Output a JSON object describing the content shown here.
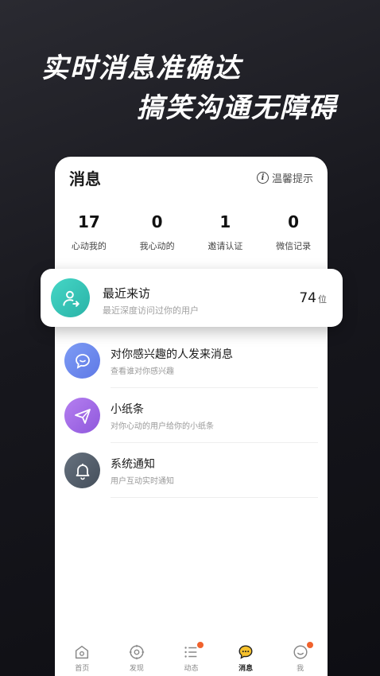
{
  "promo": {
    "headline_1": "实时消息准确达",
    "headline_2": "搞笑沟通无障碍"
  },
  "header": {
    "title": "消息",
    "tip_label": "温馨提示",
    "tip_icon": "info-icon"
  },
  "stats": [
    {
      "value": "17",
      "label": "心动我的"
    },
    {
      "value": "0",
      "label": "我心动的"
    },
    {
      "value": "1",
      "label": "邀请认证"
    },
    {
      "value": "0",
      "label": "微信记录"
    }
  ],
  "recent_visitors": {
    "title": "最近来访",
    "subtitle": "最近深度访问过你的用户",
    "count": "74",
    "unit": "位",
    "icon": "user-visit-icon",
    "color": "#3cc9bb"
  },
  "messages": [
    {
      "title": "对你感兴趣的人发来消息",
      "subtitle": "查看谁对你感兴趣",
      "icon": "chat-bubble-icon",
      "color": "#6f8cf0"
    },
    {
      "title": "小纸条",
      "subtitle": "对你心动的用户给你的小纸条",
      "icon": "paper-plane-icon",
      "color": "#a56ee8"
    },
    {
      "title": "系统通知",
      "subtitle": "用户互动实时通知",
      "icon": "bell-icon",
      "color": "#55616e"
    }
  ],
  "tabbar": [
    {
      "label": "首页",
      "icon": "home-icon",
      "active": false,
      "badge": false
    },
    {
      "label": "发现",
      "icon": "compass-icon",
      "active": false,
      "badge": false
    },
    {
      "label": "动态",
      "icon": "list-icon",
      "active": false,
      "badge": true
    },
    {
      "label": "消息",
      "icon": "message-icon",
      "active": true,
      "badge": false
    },
    {
      "label": "我",
      "icon": "profile-icon",
      "active": false,
      "badge": true
    }
  ],
  "colors": {
    "badge": "#f0622d",
    "active_tab": "#f6c12c"
  }
}
